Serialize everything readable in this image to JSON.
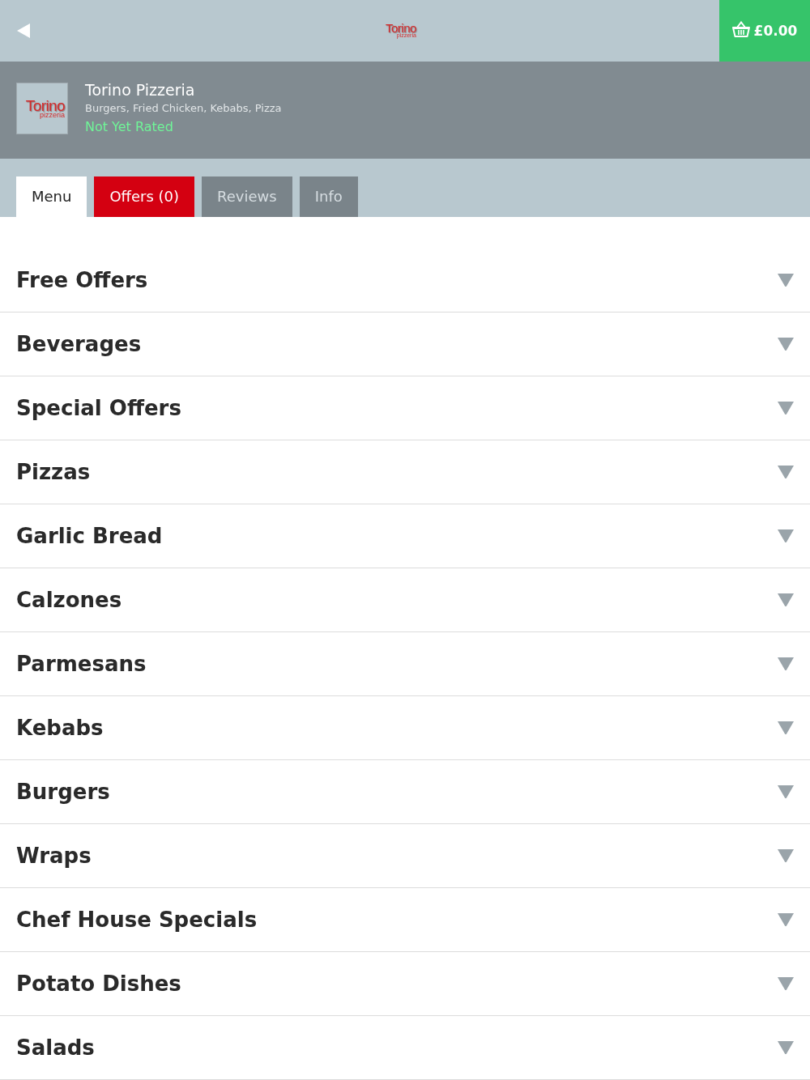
{
  "top_bar": {
    "logo": {
      "name": "Torino",
      "tagline": "pizzeria"
    },
    "basket": {
      "total": "£0.00"
    }
  },
  "restaurant": {
    "logo": {
      "name": "Torino",
      "tagline": "pizzeria"
    },
    "name": "Torino Pizzeria",
    "cuisines": "Burgers, Fried Chicken, Kebabs, Pizza",
    "rating": "Not Yet Rated"
  },
  "tabs": [
    {
      "label": "Menu",
      "selected": true,
      "disabled": false
    },
    {
      "label": "Offers (0)",
      "selected": false,
      "disabled": false
    },
    {
      "label": "Reviews",
      "selected": false,
      "disabled": true
    },
    {
      "label": "Info",
      "selected": false,
      "disabled": true
    }
  ],
  "categories": [
    {
      "name": "Free Offers",
      "expanded": false
    },
    {
      "name": "Beverages",
      "expanded": false
    },
    {
      "name": "Special Offers",
      "expanded": false
    },
    {
      "name": "Pizzas",
      "expanded": false
    },
    {
      "name": "Garlic Bread",
      "expanded": false
    },
    {
      "name": "Calzones",
      "expanded": false
    },
    {
      "name": "Parmesans",
      "expanded": false
    },
    {
      "name": "Kebabs",
      "expanded": false
    },
    {
      "name": "Burgers",
      "expanded": false
    },
    {
      "name": "Wraps",
      "expanded": false
    },
    {
      "name": "Chef House Specials",
      "expanded": false
    },
    {
      "name": "Potato Dishes",
      "expanded": false
    },
    {
      "name": "Salads",
      "expanded": false
    }
  ]
}
